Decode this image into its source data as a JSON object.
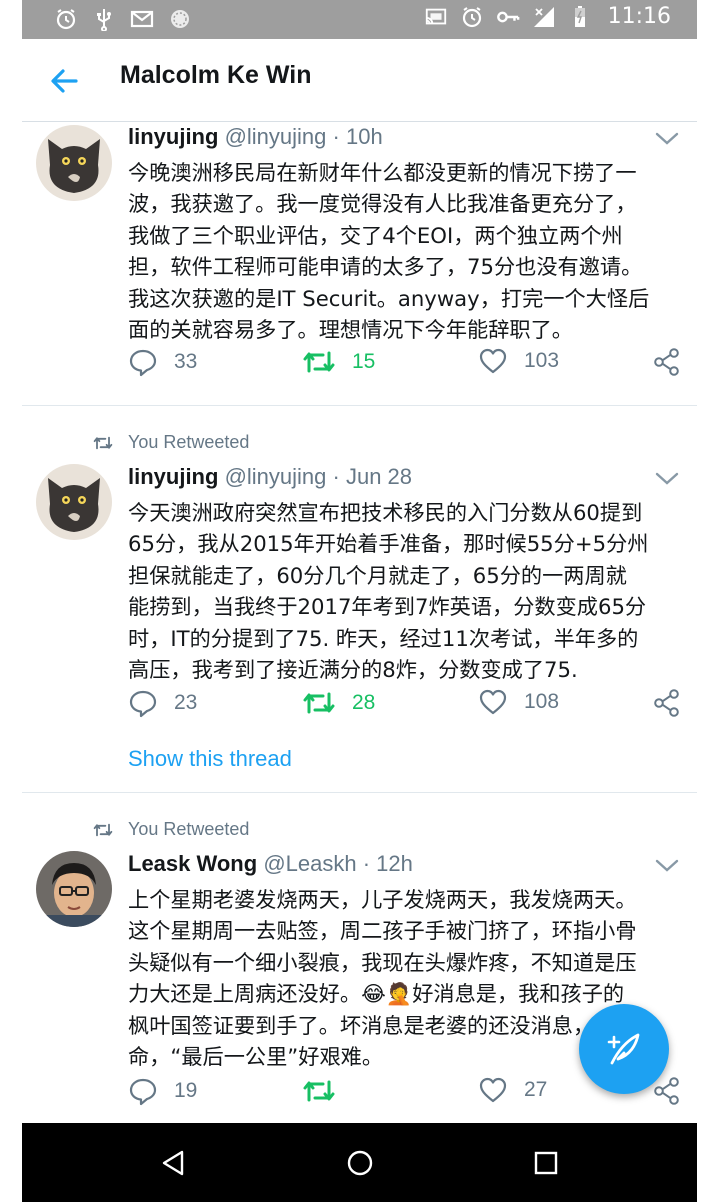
{
  "status_bar": {
    "time": "11:16",
    "left_icons": [
      "alarm-icon",
      "usb-icon",
      "gmail-icon",
      "sync-icon"
    ],
    "right_icons": [
      "cast-icon",
      "alarm-icon",
      "vpn-key-icon",
      "signal-icon",
      "battery-icon"
    ]
  },
  "header": {
    "title": "Malcolm Ke Win"
  },
  "tweets": [
    {
      "retweeted_label": "",
      "name": "linyujing",
      "handle": "@linyujing",
      "time": "· 10h",
      "avatar": "cat",
      "text_lines": [
        "今晚澳洲移民局在新财年什么都没更新的情况下捞了一",
        "波，我获邀了。我一度觉得没有人比我准备更充分了，",
        "我做了三个职业评估，交了4个EOI，两个独立两个州",
        "担，软件工程师可能申请的太多了，75分也没有邀请。",
        "我这次获邀的是IT Securit。anyway，打完一个大怪后",
        "面的关就容易多了。理想情况下今年能辞职了。"
      ],
      "replies": "33",
      "retweets": "15",
      "likes": "103"
    },
    {
      "retweeted_label": "You Retweeted",
      "name": "linyujing",
      "handle": "@linyujing",
      "time": "· Jun 28",
      "avatar": "cat",
      "text_lines": [
        "今天澳洲政府突然宣布把技术移民的入门分数从60提到",
        "65分，我从2015年开始着手准备，那时候55分+5分州",
        "担保就能走了，60分几个月就走了，65分的一两周就",
        "能捞到，当我终于2017年考到7炸英语，分数变成65分",
        "时，IT的分提到了75. 昨天，经过11次考试，半年多的",
        "高压，我考到了接近满分的8炸，分数变成了75."
      ],
      "replies": "23",
      "retweets": "28",
      "likes": "108",
      "show_thread": "Show this thread"
    },
    {
      "retweeted_label": "You Retweeted",
      "name": "Leask Wong",
      "handle": "@Leaskh",
      "time": "· 12h",
      "avatar": "person",
      "text_lines": [
        "上个星期老婆发烧两天，儿子发烧两天，我发烧两天。",
        "这个星期周一去贴签，周二孩子手被门挤了，环指小骨",
        "头疑似有一个细小裂痕，我现在头爆炸疼，不知道是压",
        "力大还是上周病还没好。😂🤦好消息是，我和孩子的",
        "枫叶国签证要到手了。坏消息是老婆的还没消息，要",
        "命，“最后一公里”好艰难。"
      ],
      "replies": "19",
      "retweets": "",
      "likes": "27"
    }
  ],
  "colors": {
    "accent": "#1da1f2",
    "retweet_green": "#17bf63",
    "secondary_text": "#657786",
    "status_bar": "#9e9e9e"
  },
  "fab": {
    "icon": "compose-tweet-icon"
  },
  "nav_bar": {
    "icons": [
      "back-triangle-icon",
      "home-circle-icon",
      "recents-square-icon"
    ]
  }
}
